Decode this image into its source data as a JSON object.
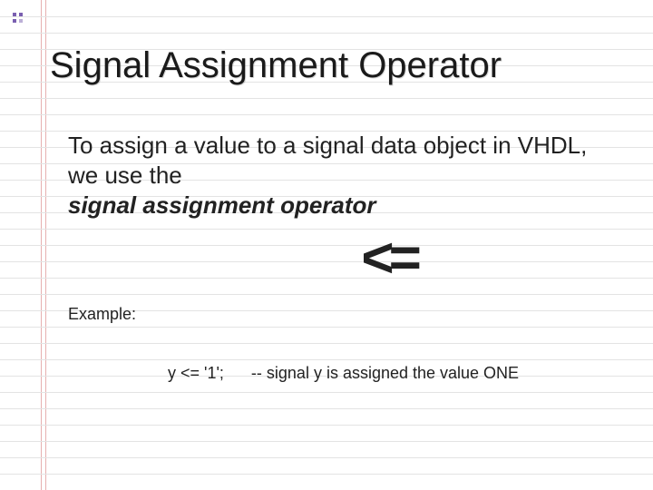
{
  "title": "Signal Assignment Operator",
  "intro": "To assign a value to a signal data object in VHDL, we use the",
  "operatorName": "signal assignment operator",
  "bigOperator": "<=",
  "exampleLabel": "Example:",
  "code": "y <= '1';",
  "comment": "-- signal y is assigned the value ONE"
}
